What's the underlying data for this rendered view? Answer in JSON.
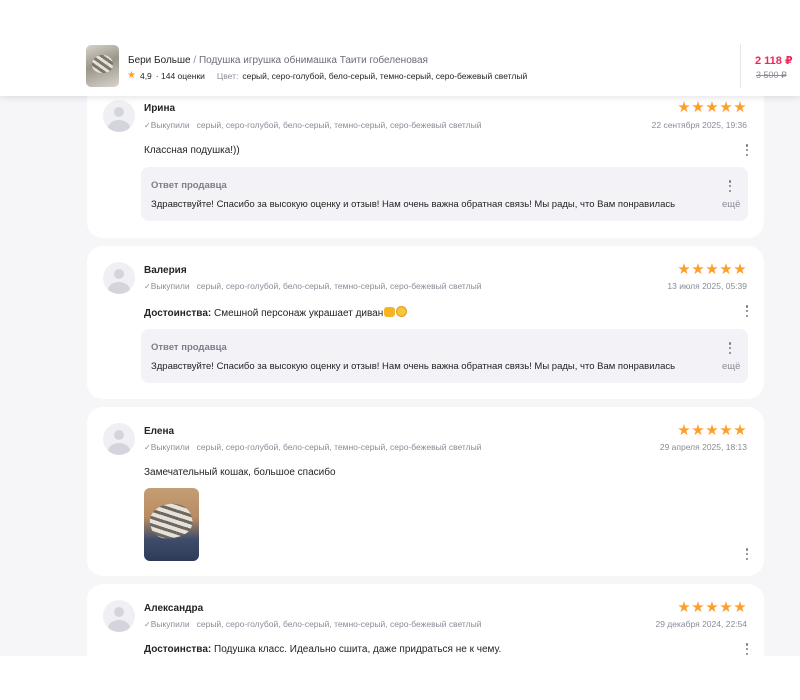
{
  "header": {
    "brand": "Бери Больше",
    "separator": " / ",
    "product_name": "Подушка игрушка обнимашка Таити гобеленовая",
    "rating": "4,9",
    "reviews_count": "· 144 оценки",
    "color_label": "Цвет:",
    "color_value": "серый, серо-голубой, бело-серый, темно-серый, серо-бежевый светлый",
    "price": "2 118 ₽",
    "old_price": "3 500 ₽",
    "colors": {
      "price": "#f0255a",
      "star": "#ff9f2a"
    },
    "icons": {
      "star": "star-icon",
      "thumbnail": "product-thumbnail"
    }
  },
  "reviews": [
    {
      "author": "Ирина",
      "rating": 5,
      "bought_label": "Выкупили",
      "colors": "серый, серо-голубой, бело-серый, темно-серый, серо-бежевый светлый",
      "date": "22 сентября 2025, 19:36",
      "text": "Классная подушка!))",
      "reply": {
        "title": "Ответ продавца",
        "text": "Здравствуйте! Спасибо за высокую оценку и отзыв! Нам очень важна обратная связь! Мы рады, что Вам понравилась",
        "more": "ещё"
      }
    },
    {
      "author": "Валерия",
      "rating": 5,
      "bought_label": "Выкупили",
      "colors": "серый, серо-голубой, бело-серый, темно-серый, серо-бежевый светлый",
      "date": "13 июля 2025, 05:39",
      "pros_label": "Достоинства:",
      "text": "Смешной персонаж украшает диван",
      "emoji": [
        "thumbs-up-emoji",
        "hugging-face-emoji"
      ],
      "reply": {
        "title": "Ответ продавца",
        "text": "Здравствуйте! Спасибо за высокую оценку и отзыв! Нам очень важна обратная связь! Мы рады, что Вам понравилась",
        "more": "ещё"
      }
    },
    {
      "author": "Елена",
      "rating": 5,
      "bought_label": "Выкупили",
      "colors": "серый, серо-голубой, бело-серый, темно-серый, серо-бежевый светлый",
      "date": "29 апреля 2025, 18:13",
      "text": "Замечательный кошак, большое спасибо",
      "photo": "review-photo-cat-pillow"
    },
    {
      "author": "Александра",
      "rating": 5,
      "bought_label": "Выкупили",
      "colors": "серый, серо-голубой, бело-серый, темно-серый, серо-бежевый светлый",
      "date": "29 декабря 2024, 22:54",
      "pros_label": "Достоинства:",
      "text": "Подушка класс. Идеально сшита, даже придраться не к чему."
    }
  ]
}
